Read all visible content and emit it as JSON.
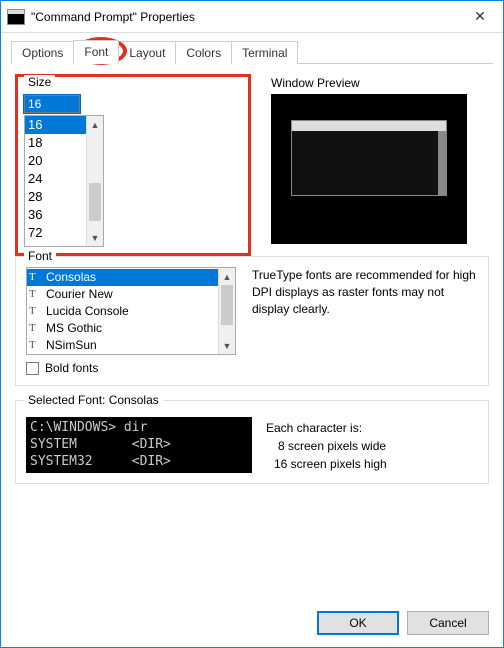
{
  "title": "\"Command Prompt\" Properties",
  "tabs": [
    "Options",
    "Font",
    "Layout",
    "Colors",
    "Terminal"
  ],
  "active_tab": "Font",
  "size": {
    "label": "Size",
    "value": "16",
    "options": [
      "16",
      "18",
      "20",
      "24",
      "28",
      "36",
      "72"
    ],
    "selected": "16"
  },
  "window_preview_label": "Window Preview",
  "font": {
    "label": "Font",
    "options": [
      "Consolas",
      "Courier New",
      "Lucida Console",
      "MS Gothic",
      "NSimSun"
    ],
    "selected": "Consolas",
    "description": "TrueType fonts are recommended for high DPI displays as raster fonts may not display clearly.",
    "bold_label": "Bold fonts"
  },
  "selected_font": {
    "label": "Selected Font: Consolas",
    "sample_line1": "C:\\WINDOWS> dir",
    "sample_line2": "SYSTEM       <DIR>",
    "sample_line3": "SYSTEM32     <DIR>",
    "char_intro": "Each character is:",
    "char_w": "8 screen pixels wide",
    "char_h": "16 screen pixels high"
  },
  "buttons": {
    "ok": "OK",
    "cancel": "Cancel"
  }
}
